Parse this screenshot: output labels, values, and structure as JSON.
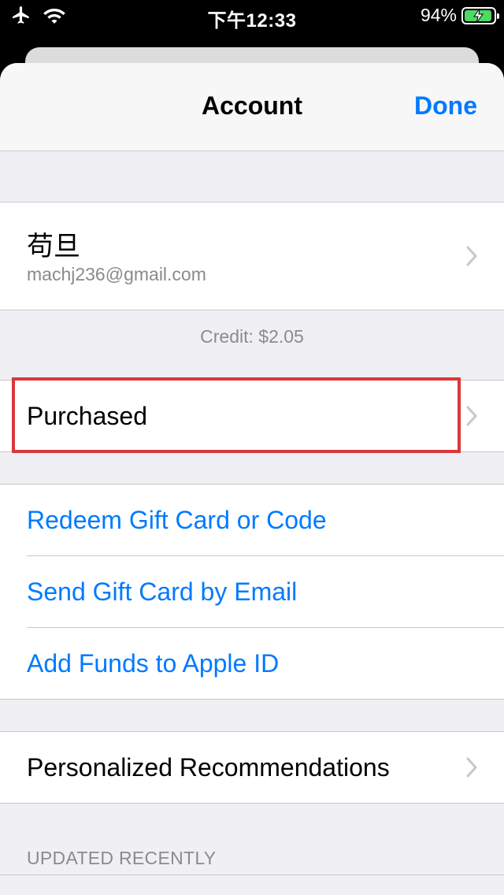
{
  "status_bar": {
    "time": "下午12:33",
    "battery": "94%",
    "battery_level": 0.94,
    "icons": [
      "airplane-icon",
      "wifi-icon",
      "battery-charging-icon"
    ]
  },
  "nav": {
    "title": "Account",
    "done_label": "Done"
  },
  "account": {
    "name": "苟旦",
    "email": "machj236@gmail.com"
  },
  "credit_text": "Credit: $2.05",
  "purchased_label": "Purchased",
  "links": [
    "Redeem Gift Card or Code",
    "Send Gift Card by Email",
    "Add Funds to Apple ID"
  ],
  "personalized_label": "Personalized Recommendations",
  "section_updated": "UPDATED RECENTLY",
  "colors": {
    "accent": "#007aff",
    "highlight": "#d9373b",
    "battery": "#4cd964"
  }
}
